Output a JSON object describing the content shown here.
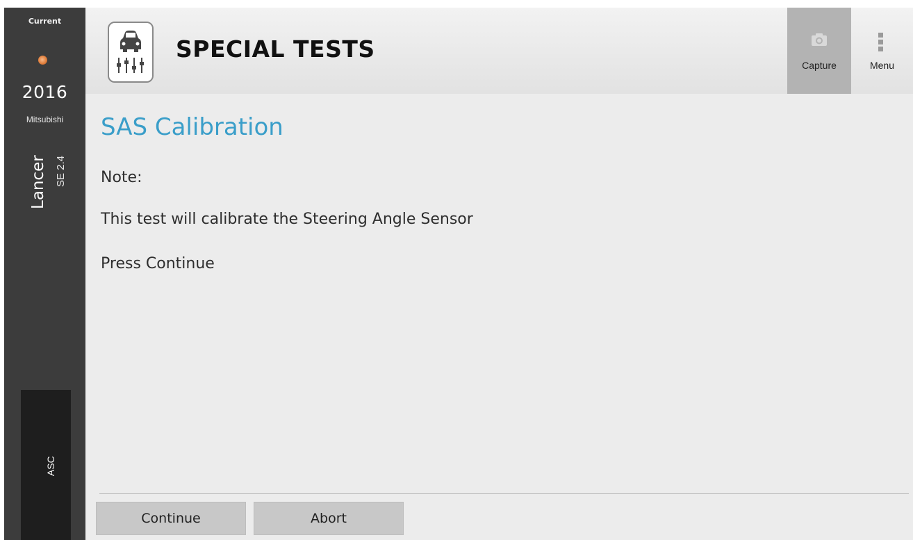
{
  "sidebar": {
    "current_label": "Current",
    "status_icon": "connection-status-icon",
    "status_color": "#e2813f",
    "year": "2016",
    "make": "Mitsubishi",
    "model": "Lancer",
    "trim": "SE 2.4",
    "system": "ASC"
  },
  "header": {
    "icon": "special-tests-icon",
    "title": "SPECIAL TESTS",
    "capture_label": "Capture",
    "capture_icon": "camera-icon",
    "menu_label": "Menu",
    "menu_icon": "more-vertical-icon"
  },
  "main": {
    "title": "SAS Calibration",
    "title_color": "#3a9ec9",
    "lines": [
      "Note:",
      "This test will calibrate the Steering Angle Sensor",
      "Press Continue"
    ]
  },
  "actions": {
    "continue_label": "Continue",
    "abort_label": "Abort"
  }
}
